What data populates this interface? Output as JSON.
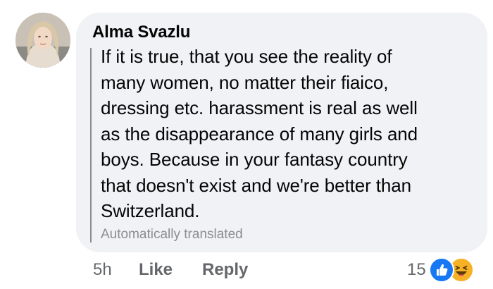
{
  "comment": {
    "author": "Alma Svazlu",
    "body": "If it is true, that you see the reality of\nmany women, no matter their fiaico,\ndressing etc. harassment is real as well\nas the disappearance of many girls and\nboys. Because in your fantasy country\nthat doesn't exist and we're better than\nSwitzerland.",
    "translation_note": "Automatically translated"
  },
  "actions": {
    "timestamp": "5h",
    "like_label": "Like",
    "reply_label": "Reply"
  },
  "reactions": {
    "count": "15",
    "icons": [
      "like-icon",
      "haha-icon"
    ]
  },
  "colors": {
    "bubble_bg": "#f0f2f5",
    "secondary_text": "#65676b",
    "like_blue": "#1877f2",
    "haha_yellow": "#f7b125"
  }
}
